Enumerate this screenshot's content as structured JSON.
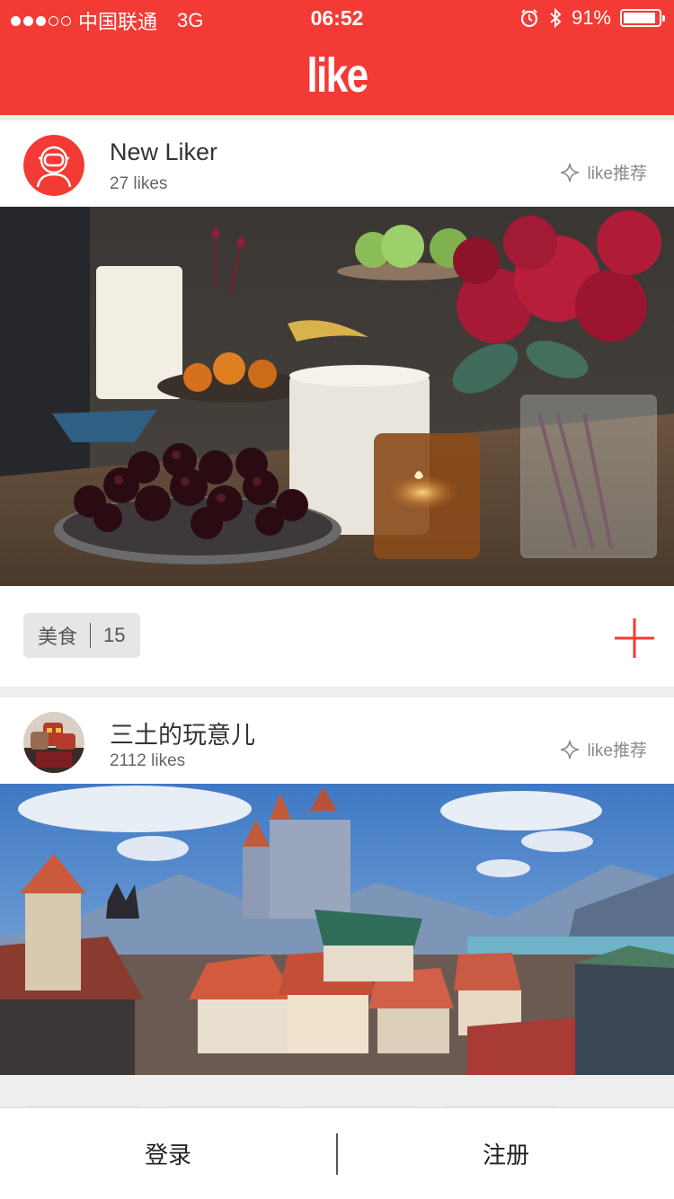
{
  "status_bar": {
    "carrier": "中国联通",
    "network": "3G",
    "time": "06:52",
    "battery": "91%",
    "battery_level": 0.91
  },
  "app": {
    "title": "like",
    "brand_color": "#f43a34"
  },
  "feed": [
    {
      "user": "New Liker",
      "likes": "27 likes",
      "recommend": "like推荐",
      "tag_label": "美食",
      "tag_count": "15"
    },
    {
      "user": "三土的玩意儿",
      "likes": "2112 likes",
      "recommend": "like推荐"
    }
  ],
  "bottom_bar": {
    "login": "登录",
    "register": "注册"
  }
}
